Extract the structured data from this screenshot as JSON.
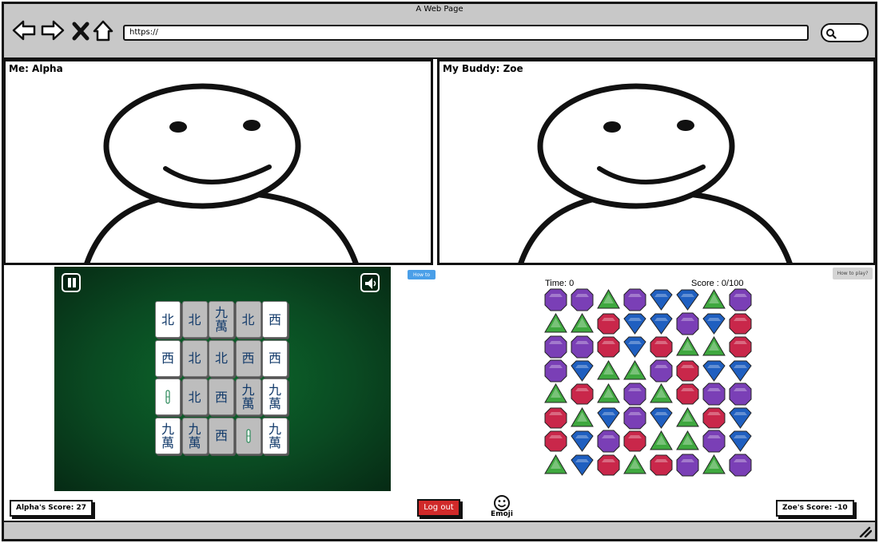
{
  "browser": {
    "title": "A Web Page",
    "url": "https://",
    "icons": [
      "back-arrow-icon",
      "forward-arrow-icon",
      "close-icon",
      "home-icon",
      "search-icon"
    ]
  },
  "video": {
    "me_label": "Me: Alpha",
    "buddy_label": "My Buddy: Zoe"
  },
  "mahjong": {
    "how_to_play": "How to play?",
    "icons": [
      "pause-icon",
      "speaker-icon"
    ],
    "tiles": [
      [
        "北",
        "北",
        "九萬",
        "北",
        "西"
      ],
      [
        "西",
        "北",
        "北",
        "西",
        "西"
      ],
      [
        "bamboo-1",
        "北",
        "西",
        "九萬",
        "九萬"
      ],
      [
        "九萬",
        "九萬",
        "西",
        "bamboo-1",
        "九萬"
      ]
    ],
    "dimmed": [
      [
        false,
        true,
        true,
        true,
        false
      ],
      [
        false,
        true,
        true,
        true,
        false
      ],
      [
        false,
        true,
        true,
        true,
        false
      ],
      [
        false,
        true,
        true,
        true,
        false
      ]
    ]
  },
  "gems": {
    "time": "Time: 0",
    "score": "Score : 0/100",
    "how_to_play": "How to play?",
    "colors": {
      "P": "#7a3fb6",
      "G": "#3fa83f",
      "R": "#c9274a",
      "B": "#1f5fc0"
    },
    "grid": [
      "PPGPBBGP",
      "GGRBBPBR",
      "PPRBRGGR",
      "PBGGPRBB",
      "GRGPGRPP",
      "RGBPBGRB",
      "RBPRGGPB",
      "GBRGRPGP"
    ]
  },
  "footer": {
    "my_score": "Alpha's Score: 27",
    "buddy_score": "Zoe's Score: -10",
    "logout": "Log out",
    "emoji": "Emoji"
  }
}
